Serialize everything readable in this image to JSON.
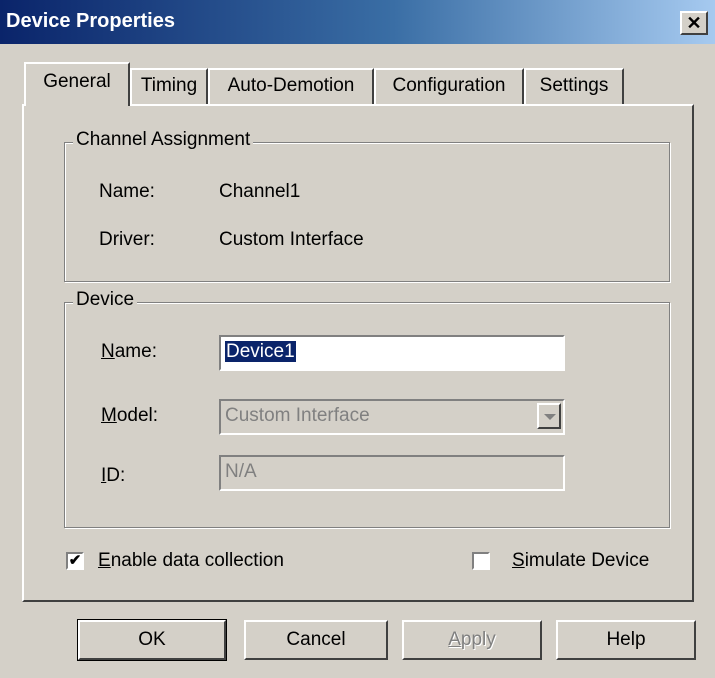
{
  "window": {
    "title": "Device Properties",
    "close_icon": "close-icon"
  },
  "tabs": [
    {
      "label": "General",
      "active": true
    },
    {
      "label": "Timing"
    },
    {
      "label": "Auto-Demotion"
    },
    {
      "label": "Configuration"
    },
    {
      "label": "Settings"
    }
  ],
  "channel_assignment": {
    "legend": "Channel Assignment",
    "name_label": "Name:",
    "name_value": "Channel1",
    "driver_label": "Driver:",
    "driver_value": "Custom Interface"
  },
  "device": {
    "legend": "Device",
    "name_label_u": "N",
    "name_label_rest": "ame:",
    "name_value": "Device1",
    "model_label_u": "M",
    "model_label_rest": "odel:",
    "model_value": "Custom Interface",
    "id_label_u": "I",
    "id_label_rest": "D:",
    "id_value": "N/A"
  },
  "options": {
    "enable_u": "E",
    "enable_rest": "nable data collection",
    "enable_checked": "✔",
    "simulate_u": "S",
    "simulate_rest": "imulate Device",
    "simulate_checked": ""
  },
  "buttons": {
    "ok": "OK",
    "cancel": "Cancel",
    "apply_u": "A",
    "apply_rest": "pply",
    "help": "Help"
  },
  "colors": {
    "titlebar_start": "#0a246a",
    "titlebar_end": "#a6caf0",
    "face": "#d4d0c8",
    "selection": "#0a246a"
  }
}
